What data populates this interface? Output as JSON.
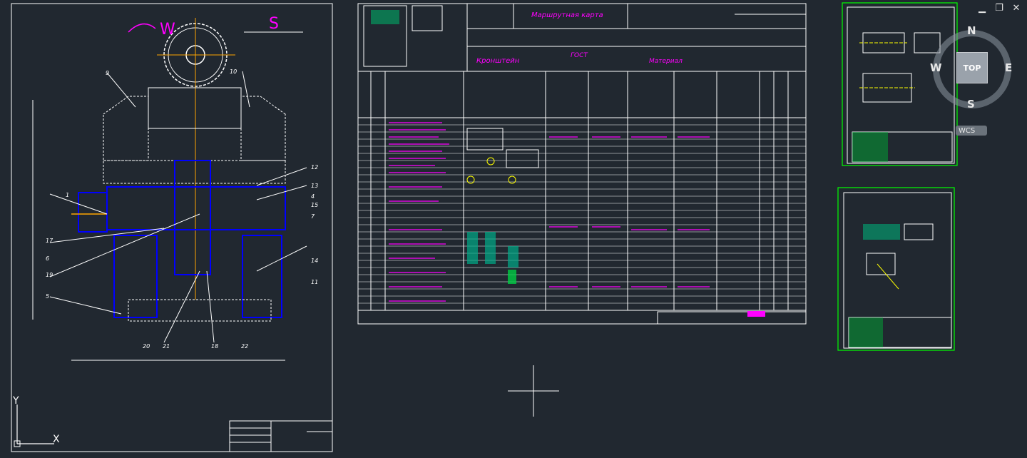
{
  "window": {
    "minimize": "▁",
    "restore": "❐",
    "close": "✕"
  },
  "viewcube": {
    "top": "TOP",
    "north": "N",
    "south": "S",
    "west": "W",
    "east": "E",
    "wcs": "WCS"
  },
  "ucs": {
    "x": "X",
    "y": "Y"
  },
  "sheet1": {
    "label_w": "W",
    "label_s": "S",
    "numbers": [
      "9",
      "10",
      "12",
      "1",
      "13",
      "4",
      "15",
      "7",
      "17",
      "6",
      "19",
      "5",
      "14",
      "11",
      "20",
      "21",
      "18",
      "22"
    ]
  },
  "sheet2": {
    "header_title": "Маршрутная карта",
    "part_name": "Кронштейн",
    "gost": "ГОСТ",
    "material": "Материал"
  },
  "colors": {
    "bg": "#212830",
    "white": "#ffffff",
    "blue": "#0000ff",
    "magenta": "#ff00ff",
    "green": "#00ff00",
    "cyan": "#00ffff",
    "yellow": "#ffff00",
    "orange": "#ff8000"
  }
}
